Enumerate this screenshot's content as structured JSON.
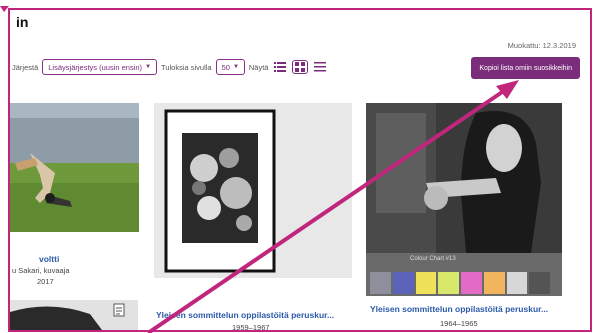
{
  "page": {
    "title": "in"
  },
  "toolbar": {
    "sort_label": "Järjestä",
    "sort_value": "Lisäysjärjestys (uusin ensin)",
    "per_page_label": "Tuloksia sivulla",
    "per_page_value": "50",
    "view_label": "Näytä"
  },
  "modified": "Muokattu: 12.3.2019",
  "copy_button": "Kopioi lista omiin suosikkeihin",
  "cards": [
    {
      "title": "voltti",
      "author": "u Sakari, kuvaaja",
      "year": "2017"
    },
    {
      "title": "Yleisen sommittelun oppilastöitä peruskur...",
      "year": "1959–1967"
    },
    {
      "title": "Yleisen sommittelun oppilastöitä peruskur...",
      "year": "1964–1965",
      "chart_label": "Colour Chart #13"
    }
  ],
  "colors": {
    "accent": "#7b2d7b",
    "annotation": "#c0267c",
    "link": "#2b5aa8"
  }
}
